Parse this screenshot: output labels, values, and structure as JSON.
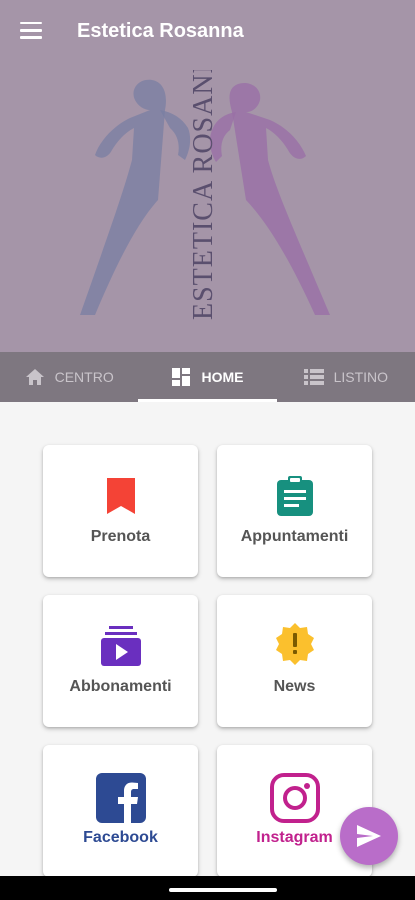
{
  "header": {
    "title": "Estetica Rosanna",
    "logo_text": "ESTETICA ROSANNA",
    "background": "#a595a8"
  },
  "tabs": [
    {
      "label": "CENTRO",
      "icon": "home-icon",
      "active": false
    },
    {
      "label": "HOME",
      "icon": "dashboard-icon",
      "active": true
    },
    {
      "label": "LISTINO",
      "icon": "list-icon",
      "active": false
    }
  ],
  "grid": [
    {
      "label": "Prenota",
      "icon": "bookmark-icon",
      "color": "#f44336"
    },
    {
      "label": "Appuntamenti",
      "icon": "clipboard-icon",
      "color": "#17907f"
    },
    {
      "label": "Abbonamenti",
      "icon": "subscriptions-icon",
      "color": "#6a2fbf"
    },
    {
      "label": "News",
      "icon": "alert-badge-icon",
      "color": "#fbc02d"
    },
    {
      "label": "Facebook",
      "icon": "facebook-icon",
      "color": "#2d4a93"
    },
    {
      "label": "Instagram",
      "icon": "instagram-icon",
      "color": "#c1218d"
    }
  ],
  "fab": {
    "icon": "send-icon",
    "color": "#b96dc9"
  }
}
